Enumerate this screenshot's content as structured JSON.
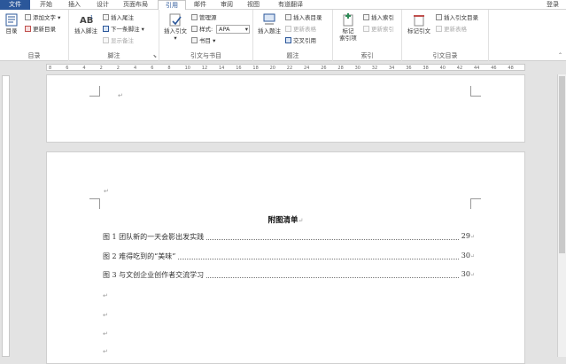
{
  "tabs": {
    "file": "文件",
    "home": "开始",
    "insert": "插入",
    "design": "设计",
    "layout": "页面布局",
    "references": "引用",
    "mailings": "邮件",
    "review": "审阅",
    "view": "视图",
    "translate": "有道翻译"
  },
  "login": "登录",
  "ribbon": {
    "toc": {
      "toc_button": "目录",
      "add_text": "添加文字",
      "update_toc": "更新目录",
      "group": "目录"
    },
    "footnotes": {
      "insert_footnote": "插入脚注",
      "insert_endnote": "插入尾注",
      "next_footnote": "下一条脚注",
      "show_notes": "显示备注",
      "group": "脚注"
    },
    "citations": {
      "insert_citation": "插入引文",
      "manage_sources": "管理源",
      "style_label": "样式:",
      "style_value": "APA",
      "bibliography": "书目",
      "group": "引文与书目"
    },
    "captions": {
      "insert_caption": "插入题注",
      "insert_table_of_figures": "插入表目录",
      "update_table": "更新表格",
      "cross_reference": "交叉引用",
      "group": "题注"
    },
    "index": {
      "mark_entry": "标记\n索引项",
      "insert_index": "插入索引",
      "update_index": "更新索引",
      "group": "索引"
    },
    "authorities": {
      "mark_citation": "标记引文",
      "insert_toa": "插入引文目录",
      "update_table": "更新表格",
      "group": "引文目录"
    }
  },
  "ruler_numbers": [
    "8",
    "6",
    "4",
    "2",
    "2",
    "4",
    "6",
    "8",
    "10",
    "12",
    "14",
    "16",
    "18",
    "20",
    "22",
    "24",
    "26",
    "28",
    "30",
    "32",
    "34",
    "36",
    "38",
    "40",
    "42",
    "44",
    "46",
    "48"
  ],
  "document": {
    "title": "附图清单",
    "entries": [
      {
        "text": "图 1 团队新的一天会影出发实践",
        "page": "29"
      },
      {
        "text": "图 2 难得吃到的“美味”",
        "page": "30"
      },
      {
        "text": "图 3 与文创企业创作者交流学习",
        "page": "30"
      }
    ],
    "para_mark": "↵"
  }
}
